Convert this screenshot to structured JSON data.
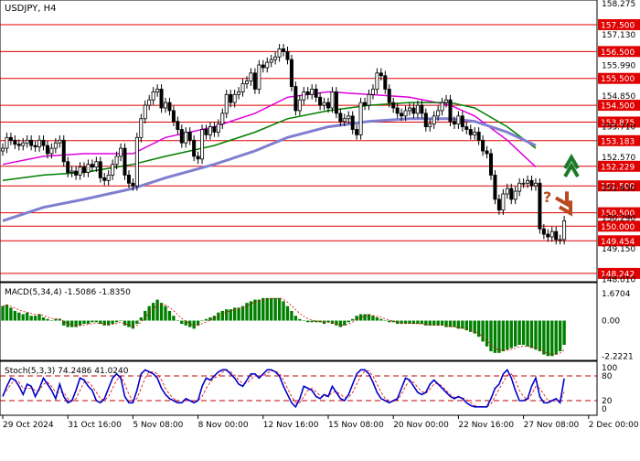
{
  "chart_data": [
    {
      "panel": "price",
      "type": "candlestick",
      "title": "USDJPY, H4",
      "ylim": [
        148.0,
        158.35
      ],
      "ytick_labels": [
        "158.275",
        "157.130",
        "155.990",
        "154.850",
        "153.710",
        "152.570",
        "151.430",
        "150.290",
        "149.150",
        "148.010"
      ],
      "ytick_values": [
        158.275,
        157.13,
        155.99,
        154.85,
        153.71,
        152.57,
        151.43,
        150.29,
        149.15,
        148.01
      ],
      "levels": [
        {
          "label": "157.500",
          "value": 157.5
        },
        {
          "label": "156.500",
          "value": 156.5
        },
        {
          "label": "155.500",
          "value": 155.5
        },
        {
          "label": "154.500",
          "value": 154.5
        },
        {
          "label": "153.875",
          "value": 153.875
        },
        {
          "label": "153.183",
          "value": 153.183
        },
        {
          "label": "152.229",
          "value": 152.229
        },
        {
          "label": "151.500",
          "value": 151.5
        },
        {
          "label": "150.500",
          "value": 150.5
        },
        {
          "label": "150.000",
          "value": 150.0
        },
        {
          "label": "149.454",
          "value": 149.454
        },
        {
          "label": "148.242",
          "value": 148.242
        }
      ],
      "close": [
        152.9,
        153.3,
        153.2,
        153.05,
        153.0,
        153.1,
        153.2,
        153.0,
        152.95,
        153.2,
        153.0,
        152.7,
        152.9,
        153.1,
        153.2,
        152.4,
        152.0,
        152.05,
        151.9,
        152.2,
        152.0,
        152.3,
        152.2,
        152.4,
        151.8,
        151.7,
        151.9,
        152.3,
        152.6,
        152.9,
        151.9,
        151.6,
        151.5,
        153.3,
        154.0,
        154.5,
        154.7,
        155.0,
        155.1,
        154.4,
        154.6,
        154.3,
        153.9,
        153.6,
        153.1,
        153.5,
        153.2,
        152.6,
        152.5,
        153.6,
        153.4,
        153.7,
        153.5,
        153.8,
        154.2,
        154.9,
        154.6,
        154.9,
        155.0,
        155.3,
        155.4,
        155.7,
        155.1,
        156.0,
        155.9,
        156.1,
        156.2,
        156.3,
        156.6,
        156.5,
        156.2,
        155.2,
        154.3,
        154.7,
        155.0,
        154.9,
        155.1,
        154.8,
        154.5,
        154.6,
        154.4,
        155.0,
        154.2,
        153.9,
        154.0,
        154.1,
        153.6,
        153.4,
        154.6,
        154.5,
        154.9,
        155.1,
        155.7,
        155.6,
        155.1,
        154.6,
        154.4,
        154.2,
        154.1,
        154.3,
        154.4,
        154.2,
        154.5,
        154.2,
        153.7,
        153.8,
        154.1,
        154.3,
        154.6,
        154.7,
        153.9,
        153.8,
        154.1,
        153.7,
        153.6,
        153.4,
        153.5,
        153.2,
        152.8,
        152.7,
        151.9,
        151.0,
        150.6,
        151.2,
        151.4,
        151.0,
        151.3,
        151.6,
        151.6,
        151.7,
        151.5,
        151.6,
        149.9,
        149.7,
        149.6,
        149.8,
        149.5,
        149.5,
        150.2
      ],
      "series": [
        {
          "name": "",
          "color": "#dd00dd",
          "values": [
            [
              0,
              152.3
            ],
            [
              10,
              152.6
            ],
            [
              20,
              152.7
            ],
            [
              32,
              152.7
            ],
            [
              40,
              153.3
            ],
            [
              52,
              153.7
            ],
            [
              62,
              154.2
            ],
            [
              70,
              154.8
            ],
            [
              80,
              155.0
            ],
            [
              90,
              154.9
            ],
            [
              100,
              154.8
            ],
            [
              110,
              154.5
            ],
            [
              116,
              154.1
            ],
            [
              124,
              153.2
            ],
            [
              131,
              152.2
            ]
          ]
        },
        {
          "name": "",
          "color": "#007f00",
          "values": [
            [
              0,
              151.7
            ],
            [
              10,
              151.9
            ],
            [
              20,
              152.0
            ],
            [
              32,
              152.3
            ],
            [
              40,
              152.6
            ],
            [
              52,
              153.0
            ],
            [
              62,
              153.5
            ],
            [
              70,
              154.0
            ],
            [
              80,
              154.3
            ],
            [
              90,
              154.5
            ],
            [
              100,
              154.6
            ],
            [
              110,
              154.6
            ],
            [
              116,
              154.4
            ],
            [
              124,
              153.7
            ],
            [
              131,
              152.9
            ]
          ]
        },
        {
          "name": "",
          "color": "#7f7fd0",
          "values": [
            [
              0,
              150.2
            ],
            [
              10,
              150.7
            ],
            [
              20,
              151.0
            ],
            [
              32,
              151.4
            ],
            [
              40,
              151.8
            ],
            [
              52,
              152.3
            ],
            [
              62,
              152.8
            ],
            [
              70,
              153.3
            ],
            [
              80,
              153.7
            ],
            [
              90,
              153.9
            ],
            [
              100,
              154.0
            ],
            [
              110,
              154.0
            ],
            [
              116,
              153.9
            ],
            [
              124,
              153.5
            ],
            [
              131,
              153.0
            ]
          ]
        }
      ],
      "annotations": [
        "?"
      ]
    },
    {
      "panel": "macd",
      "type": "bar",
      "label": "MACD(5,34,4) -1.5086 -1.8350",
      "ytick_labels": [
        "1.6704",
        "0.00",
        "-2.2221"
      ],
      "ytick_values": [
        1.6704,
        0.0,
        -2.2221
      ],
      "ylim": [
        -2.35,
        1.9
      ],
      "values": [
        0.9,
        1.0,
        0.8,
        0.6,
        0.5,
        0.4,
        0.5,
        0.3,
        0.3,
        0.4,
        0.2,
        0.1,
        0.0,
        0.1,
        0.1,
        -0.3,
        -0.4,
        -0.4,
        -0.4,
        -0.3,
        -0.2,
        -0.2,
        -0.1,
        -0.1,
        -0.2,
        -0.3,
        -0.3,
        -0.2,
        -0.1,
        0.0,
        -0.3,
        -0.4,
        -0.5,
        -0.2,
        0.2,
        0.6,
        0.9,
        1.1,
        1.3,
        1.1,
        0.9,
        0.6,
        0.3,
        0.0,
        -0.2,
        -0.3,
        -0.4,
        -0.5,
        -0.3,
        0.0,
        0.1,
        0.2,
        0.3,
        0.5,
        0.6,
        0.7,
        0.7,
        0.8,
        0.8,
        0.9,
        1.1,
        1.2,
        1.3,
        1.3,
        1.4,
        1.4,
        1.4,
        1.4,
        1.4,
        1.2,
        0.9,
        0.6,
        0.3,
        0.1,
        0.0,
        -0.1,
        -0.1,
        -0.1,
        -0.1,
        -0.2,
        -0.1,
        -0.2,
        -0.3,
        -0.4,
        -0.3,
        -0.1,
        0.1,
        0.3,
        0.4,
        0.4,
        0.4,
        0.3,
        0.2,
        0.1,
        0.0,
        -0.1,
        -0.1,
        -0.2,
        -0.2,
        -0.2,
        -0.2,
        -0.2,
        -0.2,
        -0.2,
        -0.3,
        -0.3,
        -0.3,
        -0.3,
        -0.3,
        -0.4,
        -0.4,
        -0.4,
        -0.5,
        -0.5,
        -0.6,
        -0.7,
        -0.8,
        -1.0,
        -1.3,
        -1.6,
        -1.9,
        -2.0,
        -2.0,
        -1.9,
        -1.8,
        -1.7,
        -1.6,
        -1.5,
        -1.5,
        -1.6,
        -1.7,
        -1.8,
        -1.9,
        -2.1,
        -2.2,
        -2.2,
        -2.1,
        -1.9,
        -1.5
      ]
    },
    {
      "panel": "stochastic",
      "type": "line",
      "label": "Stoch(5,3,3) 74.2486 41.0240",
      "ytick_labels": [
        "100",
        "80",
        "20",
        "0"
      ],
      "ytick_values": [
        100,
        80,
        20,
        0
      ],
      "ylim": [
        0,
        100
      ],
      "levels": [
        80,
        20
      ],
      "values": [
        30,
        55,
        75,
        70,
        55,
        35,
        60,
        55,
        30,
        50,
        75,
        60,
        45,
        25,
        60,
        30,
        15,
        20,
        45,
        75,
        70,
        55,
        45,
        20,
        15,
        25,
        50,
        75,
        85,
        75,
        30,
        15,
        15,
        45,
        85,
        95,
        90,
        85,
        75,
        50,
        35,
        25,
        20,
        15,
        15,
        25,
        20,
        15,
        20,
        55,
        75,
        70,
        80,
        90,
        95,
        95,
        85,
        75,
        60,
        55,
        70,
        85,
        85,
        75,
        85,
        95,
        95,
        90,
        80,
        55,
        35,
        15,
        5,
        25,
        55,
        50,
        45,
        30,
        25,
        35,
        30,
        55,
        40,
        25,
        20,
        35,
        60,
        85,
        95,
        95,
        85,
        65,
        40,
        25,
        20,
        15,
        20,
        25,
        50,
        75,
        70,
        55,
        40,
        35,
        40,
        60,
        70,
        60,
        50,
        40,
        30,
        25,
        30,
        25,
        15,
        8,
        5,
        5,
        5,
        5,
        25,
        50,
        60,
        85,
        95,
        75,
        45,
        20,
        20,
        25,
        55,
        75,
        30,
        15,
        15,
        20,
        25,
        15,
        74
      ],
      "signal": [
        35,
        45,
        60,
        70,
        65,
        50,
        50,
        50,
        45,
        45,
        60,
        65,
        55,
        40,
        40,
        40,
        25,
        20,
        25,
        45,
        65,
        65,
        55,
        40,
        25,
        20,
        30,
        50,
        70,
        80,
        60,
        35,
        20,
        25,
        50,
        75,
        90,
        90,
        85,
        70,
        50,
        35,
        25,
        20,
        15,
        20,
        20,
        20,
        20,
        30,
        50,
        65,
        75,
        80,
        90,
        93,
        90,
        82,
        70,
        62,
        62,
        72,
        80,
        80,
        80,
        87,
        92,
        92,
        86,
        70,
        50,
        30,
        15,
        15,
        30,
        45,
        50,
        42,
        32,
        30,
        30,
        40,
        42,
        35,
        28,
        28,
        40,
        60,
        80,
        92,
        92,
        80,
        60,
        40,
        25,
        20,
        18,
        22,
        35,
        55,
        68,
        65,
        52,
        42,
        38,
        48,
        60,
        62,
        55,
        45,
        35,
        28,
        28,
        27,
        22,
        15,
        8,
        6,
        5,
        5,
        12,
        30,
        48,
        65,
        82,
        85,
        70,
        45,
        30,
        22,
        35,
        55,
        50,
        35,
        20,
        18,
        20,
        20,
        41
      ]
    }
  ],
  "xaxis": {
    "labels": [
      "29 Oct 2024",
      "31 Oct 16:00",
      "5 Nov 08:00",
      "8 Nov 00:00",
      "12 Nov 16:00",
      "15 Nov 08:00",
      "20 Nov 00:00",
      "22 Nov 16:00",
      "27 Nov 08:00",
      "2 Dec 00:00"
    ],
    "label_index": [
      0,
      16,
      32,
      48,
      64,
      80,
      96,
      112,
      128,
      144
    ]
  },
  "colors": {
    "up_candle": "#ffffff",
    "down_candle": "#000000",
    "level_line": "#e00000",
    "macd_bar": "#008000",
    "macd_signal": "#e00000",
    "stoch_main": "#0000c8",
    "stoch_signal": "#e00000",
    "arrow_up": "#1a7a2a",
    "arrow_down": "#b84a1f"
  },
  "icons": {
    "forecast_up": "green-chevron-up-arrow",
    "forecast_down": "brown-chevron-down-arrow"
  }
}
